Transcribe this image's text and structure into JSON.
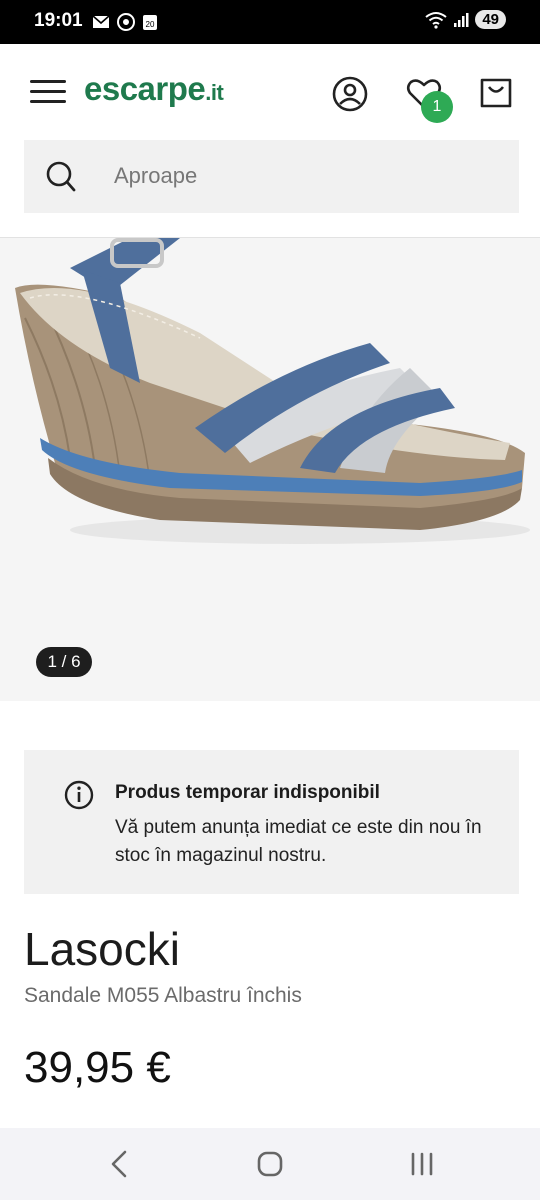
{
  "status_bar": {
    "time": "19:01",
    "battery": "49"
  },
  "header": {
    "logo_main": "escarpe",
    "logo_tld": ".it",
    "wishlist_count": "1"
  },
  "search": {
    "placeholder": "Aproape"
  },
  "gallery": {
    "counter": "1 / 6"
  },
  "notice": {
    "title": "Produs temporar indisponibil",
    "body": "Vă putem anunța imediat ce este din nou în stoc în magazinul nostru."
  },
  "product": {
    "brand": "Lasocki",
    "name": "Sandale M055 Albastru închis",
    "price": "39,95 €"
  },
  "colors": {
    "brand_green": "#1f7a4d",
    "badge_green": "#2eaa55"
  }
}
